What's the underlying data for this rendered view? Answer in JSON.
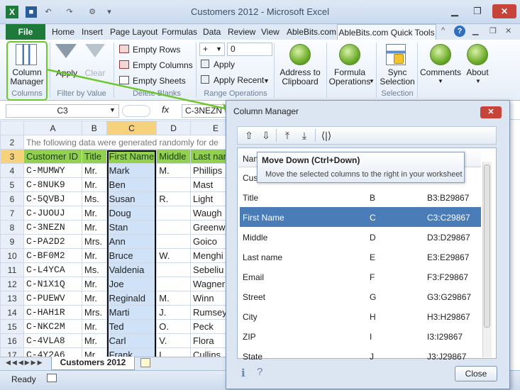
{
  "window": {
    "title": "Customers 2012  -  Microsoft Excel",
    "minimize": "▁",
    "restore": "❐",
    "close": "✕"
  },
  "ribbon_tabs": [
    "File",
    "Home",
    "Insert",
    "Page Layout",
    "Formulas",
    "Data",
    "Review",
    "View",
    "AbleBits.com",
    "AbleBits.com Quick Tools"
  ],
  "ribbon": {
    "column_manager": "Column\nManager",
    "columns_group": "Columns",
    "apply": "Apply",
    "clear": "Clear",
    "filter_group": "Filter by Value",
    "empty_rows": "Empty Rows",
    "empty_columns": "Empty Columns",
    "empty_sheets": "Empty Sheets",
    "delete_blanks_group": "Delete Blanks",
    "op_value": "+",
    "op_number": "0",
    "op_apply": "Apply",
    "apply_recent": "Apply Recent",
    "range_ops_group": "Range Operations",
    "address_to_clipboard": "Address to\nClipboard",
    "formula_operations": "Formula\nOperations",
    "sync_selection": "Sync\nSelection",
    "selection_group": "Selection",
    "comments": "Comments",
    "about": "About"
  },
  "formula_bar": {
    "name_box": "C3",
    "fx": "fx",
    "value": "C-3NEZN"
  },
  "sheet": {
    "col_headers": [
      "A",
      "B",
      "C",
      "D",
      "E"
    ],
    "row2_note": "The following data were generated randomly for de",
    "header_row": [
      "Customer ID",
      "Title",
      "First Name",
      "Middle",
      "Last nan"
    ],
    "rows": [
      [
        "4",
        "C-MUMWY",
        "Mr.",
        "Mark",
        "M.",
        "Phillips"
      ],
      [
        "5",
        "C-8NUK9",
        "Mr.",
        "Ben",
        "",
        "Mast"
      ],
      [
        "6",
        "C-5QVBJ",
        "Ms.",
        "Susan",
        "R.",
        "Light"
      ],
      [
        "7",
        "C-JUOUJ",
        "Mr.",
        "Doug",
        "",
        "Waugh"
      ],
      [
        "8",
        "C-3NEZN",
        "Mr.",
        "Stan",
        "",
        "Greenw"
      ],
      [
        "9",
        "C-PA2D2",
        "Mrs.",
        "Ann",
        "",
        "Goico"
      ],
      [
        "10",
        "C-BF0M2",
        "Mr.",
        "Bruce",
        "W.",
        "Menghi"
      ],
      [
        "11",
        "C-L4YCA",
        "Ms.",
        "Valdenia",
        "",
        "Sebeliu"
      ],
      [
        "12",
        "C-N1X1Q",
        "Mr.",
        "Joe",
        "",
        "Wagner"
      ],
      [
        "13",
        "C-PUEWV",
        "Mr.",
        "Reginald",
        "M.",
        "Winn"
      ],
      [
        "14",
        "C-HAH1R",
        "Mrs.",
        "Marti",
        "J.",
        "Rumsey"
      ],
      [
        "15",
        "C-NKC2M",
        "Mr.",
        "Ted",
        "O.",
        "Peck"
      ],
      [
        "16",
        "C-4VLA8",
        "Mr.",
        "Carl",
        "V.",
        "Flora"
      ],
      [
        "17",
        "C-4Y2A6",
        "Mr.",
        "Frank",
        "L.",
        "Cullins"
      ]
    ],
    "tab_name": "Customers 2012",
    "status": "Ready"
  },
  "column_manager": {
    "title": "Column Manager",
    "close_x": "✕",
    "tooltip_title": "Move Down (Ctrl+Down)",
    "tooltip_text": "Move the selected columns to the right in your worksheet",
    "list_header": "Nam",
    "items": [
      {
        "name": "Cust",
        "col": "",
        "range": ""
      },
      {
        "name": "Title",
        "col": "B",
        "range": "B3:B29867"
      },
      {
        "name": "First Name",
        "col": "C",
        "range": "C3:C29867"
      },
      {
        "name": "Middle",
        "col": "D",
        "range": "D3:D29867"
      },
      {
        "name": "Last name",
        "col": "E",
        "range": "E3:E29867"
      },
      {
        "name": "Email",
        "col": "F",
        "range": "F3:F29867"
      },
      {
        "name": "Street",
        "col": "G",
        "range": "G3:G29867"
      },
      {
        "name": "City",
        "col": "H",
        "range": "H3:H29867"
      },
      {
        "name": "ZIP",
        "col": "I",
        "range": "I3:I29867"
      },
      {
        "name": "State",
        "col": "J",
        "range": "J3:J29867"
      }
    ],
    "info": "i",
    "help": "?",
    "close_button": "Close"
  },
  "colors": {
    "accent_green": "#6ec72d",
    "selected_row": "#4a7cb8",
    "header_fill": "#92d050"
  }
}
